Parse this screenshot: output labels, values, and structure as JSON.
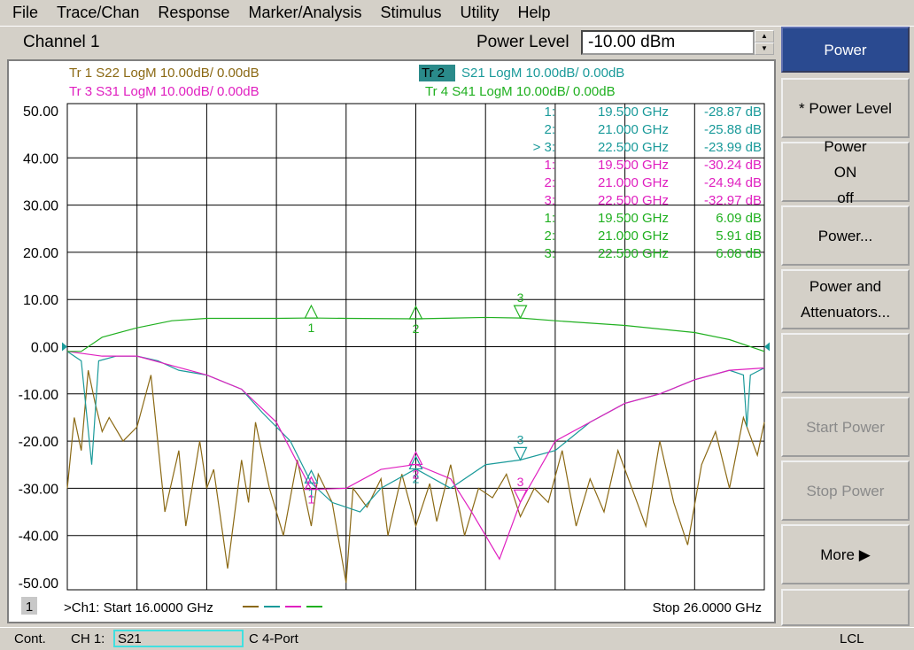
{
  "menu": [
    "File",
    "Trace/Chan",
    "Response",
    "Marker/Analysis",
    "Stimulus",
    "Utility",
    "Help"
  ],
  "channel_title": "Channel 1",
  "power_level": {
    "label": "Power Level",
    "value": "-10.00 dBm"
  },
  "traces": [
    {
      "label": "Tr 1  S22 LogM 10.00dB/  0.00dB",
      "color": "#8b6914"
    },
    {
      "label": "Tr 2",
      "rest": "S21 LogM 10.00dB/  0.00dB",
      "color": "#1a9a9a",
      "active": true
    },
    {
      "label": "Tr 3  S31 LogM 10.00dB/  0.00dB",
      "color": "#e020c0"
    },
    {
      "label": "Tr 4  S41 LogM 10.00dB/  0.00dB",
      "color": "#20b020"
    }
  ],
  "markers_table": [
    {
      "id": "1:",
      "freq": "19.500 GHz",
      "val": "-28.87 dB",
      "trace": 1
    },
    {
      "id": "2:",
      "freq": "21.000 GHz",
      "val": "-25.88 dB",
      "trace": 1
    },
    {
      "id": "> 3:",
      "freq": "22.500 GHz",
      "val": "-23.99 dB",
      "trace": 1
    },
    {
      "id": "1:",
      "freq": "19.500 GHz",
      "val": "-30.24 dB",
      "trace": 2
    },
    {
      "id": "2:",
      "freq": "21.000 GHz",
      "val": "-24.94 dB",
      "trace": 2
    },
    {
      "id": "3:",
      "freq": "22.500 GHz",
      "val": "-32.97 dB",
      "trace": 2
    },
    {
      "id": "1:",
      "freq": "19.500 GHz",
      "val": "6.09 dB",
      "trace": 3
    },
    {
      "id": "2:",
      "freq": "21.000 GHz",
      "val": "5.91 dB",
      "trace": 3
    },
    {
      "id": "3:",
      "freq": "22.500 GHz",
      "val": "6.08 dB",
      "trace": 3
    }
  ],
  "chart_data": {
    "type": "line",
    "x_unit": "GHz",
    "xlim": [
      16,
      26
    ],
    "ylim": [
      -50,
      50
    ],
    "yticks": [
      "50.00",
      "40.00",
      "30.00",
      "20.00",
      "10.00",
      "0.00",
      "-10.00",
      "-20.00",
      "-30.00",
      "-40.00",
      "-50.00"
    ],
    "grid": true,
    "series": [
      {
        "name": "S22",
        "color": "#8b6914",
        "x": [
          16,
          16.1,
          16.2,
          16.3,
          16.4,
          16.5,
          16.6,
          16.8,
          17,
          17.2,
          17.4,
          17.6,
          17.7,
          17.9,
          18,
          18.1,
          18.3,
          18.5,
          18.6,
          18.7,
          18.9,
          19.1,
          19.3,
          19.5,
          19.6,
          19.8,
          20,
          20.1,
          20.3,
          20.5,
          20.6,
          20.8,
          21,
          21.2,
          21.3,
          21.5,
          21.7,
          21.9,
          22.1,
          22.3,
          22.5,
          22.7,
          22.9,
          23.1,
          23.3,
          23.5,
          23.7,
          23.9,
          24.1,
          24.3,
          24.5,
          24.7,
          24.9,
          25.1,
          25.3,
          25.5,
          25.7,
          25.9,
          26
        ],
        "y": [
          -30,
          -15,
          -22,
          -5,
          -12,
          -18,
          -15,
          -20,
          -17,
          -6,
          -35,
          -22,
          -38,
          -20,
          -30,
          -26,
          -47,
          -24,
          -33,
          -16,
          -30,
          -40,
          -24,
          -38,
          -27,
          -33,
          -50,
          -30,
          -34,
          -28,
          -40,
          -27,
          -38,
          -29,
          -37,
          -25,
          -40,
          -30,
          -32,
          -27,
          -36,
          -30,
          -33,
          -22,
          -38,
          -28,
          -35,
          -22,
          -30,
          -38,
          -20,
          -33,
          -42,
          -25,
          -18,
          -30,
          -15,
          -23,
          -16
        ]
      },
      {
        "name": "S21",
        "color": "#1a9a9a",
        "x": [
          16,
          16.2,
          16.35,
          16.45,
          16.7,
          17,
          17.3,
          17.6,
          18,
          18.5,
          18.8,
          19.2,
          19.5,
          19.8,
          20.2,
          20.5,
          21,
          21.5,
          22,
          22.5,
          23,
          23.5,
          24,
          24.5,
          25,
          25.5,
          25.7,
          25.75,
          25.8,
          26
        ],
        "y": [
          -1,
          -3,
          -25,
          -3,
          -2,
          -2,
          -3,
          -5,
          -6,
          -9,
          -14,
          -20,
          -28.87,
          -33,
          -35,
          -30,
          -25.88,
          -30,
          -25,
          -23.99,
          -22,
          -16,
          -12,
          -10,
          -7,
          -5,
          -6,
          -17,
          -6,
          -4.5
        ]
      },
      {
        "name": "S31",
        "color": "#e020c0",
        "x": [
          16,
          16.5,
          17,
          17.5,
          18,
          18.5,
          19,
          19.5,
          20,
          20.5,
          21,
          21.5,
          21.8,
          22.2,
          22.5,
          23,
          23.5,
          24,
          24.5,
          25,
          25.5,
          26
        ],
        "y": [
          -1,
          -2,
          -2,
          -4,
          -6,
          -9,
          -16,
          -30.24,
          -30,
          -26,
          -24.94,
          -28,
          -35,
          -45,
          -32.97,
          -20,
          -16,
          -12,
          -10,
          -7,
          -5,
          -4.5
        ]
      },
      {
        "name": "S41",
        "color": "#20b020",
        "x": [
          16,
          16.2,
          16.5,
          17,
          17.5,
          18,
          19,
          19.5,
          20,
          21,
          22,
          22.5,
          23,
          24,
          25,
          25.5,
          26
        ],
        "y": [
          -1,
          -1,
          2,
          4,
          5.5,
          6,
          6,
          6.09,
          6,
          5.91,
          6.2,
          6.08,
          5.5,
          4.5,
          3,
          1.5,
          -1
        ]
      }
    ],
    "markers": [
      {
        "x": 19.5,
        "label": "1"
      },
      {
        "x": 21,
        "label": "2"
      },
      {
        "x": 22.5,
        "label": "3"
      }
    ]
  },
  "footer": {
    "channel_num": "1",
    "start": ">Ch1: Start  16.0000 GHz",
    "stop": "Stop  26.0000 GHz"
  },
  "softkeys": [
    "Power",
    "* Power Level",
    "Power|ON | off",
    "Power...",
    "Power and|Attenuators...",
    "",
    "Start Power",
    "Stop Power",
    "More ▶",
    ""
  ],
  "status": {
    "mode": "Cont.",
    "ch": "CH 1:",
    "meas": "S21",
    "cal": "C  4-Port",
    "lcl": "LCL"
  }
}
